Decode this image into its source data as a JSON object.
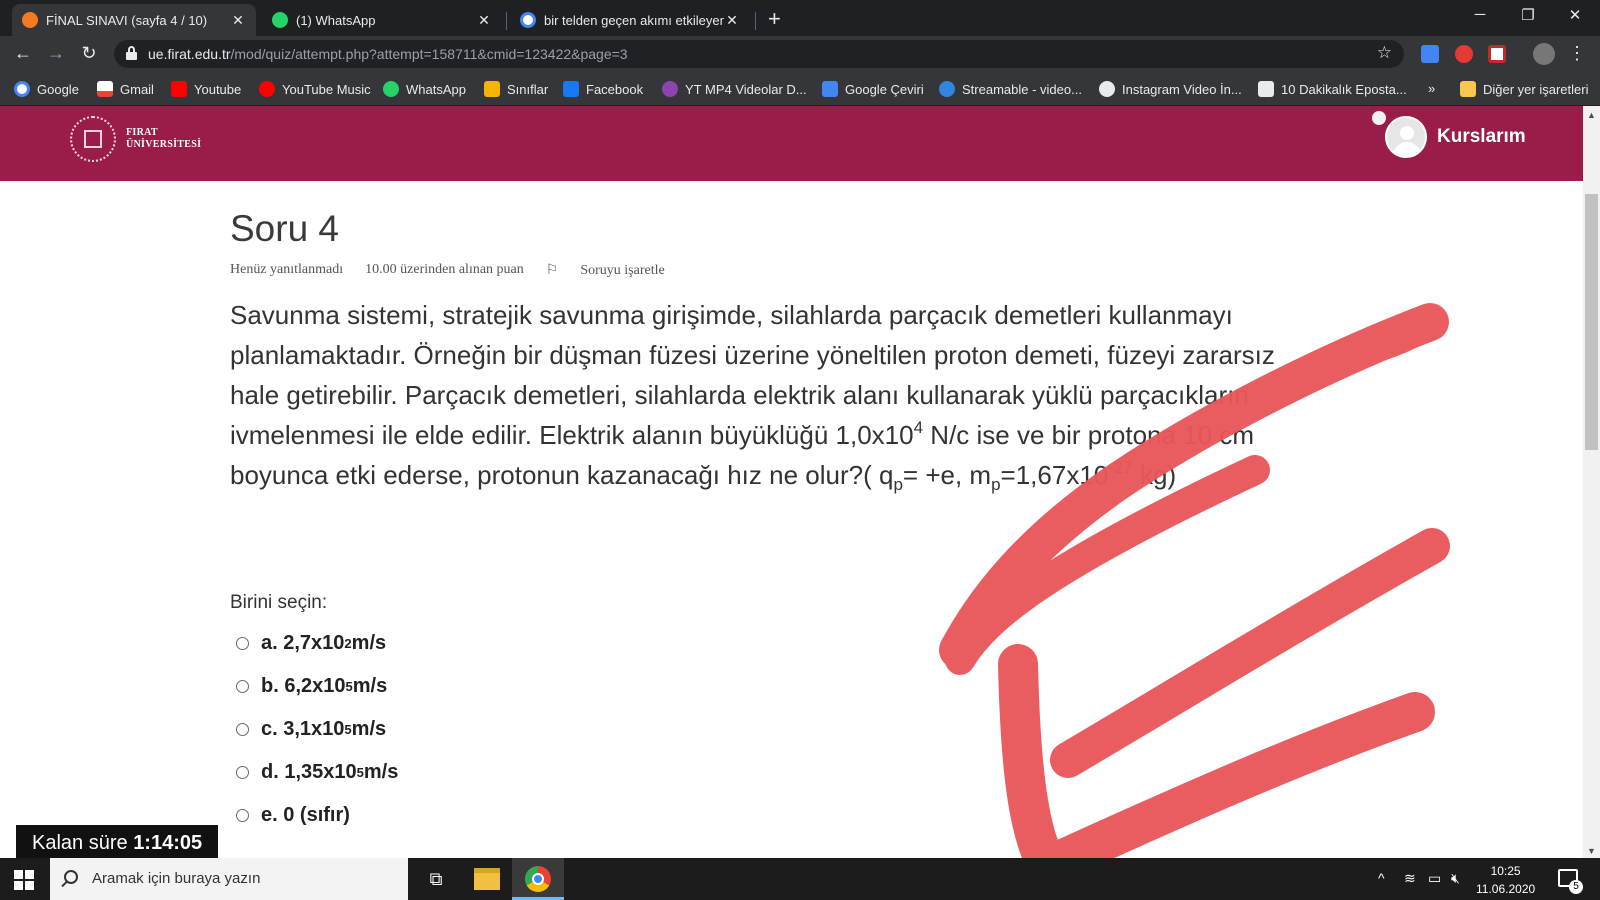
{
  "browser": {
    "tabs": [
      {
        "title": "FİNAL SINAVI (sayfa 4 / 10)",
        "active": true
      },
      {
        "title": "(1) WhatsApp",
        "active": false
      },
      {
        "title": "bir telden geçen akımı etkileyenle",
        "active": false
      }
    ],
    "url_host": "ue.firat.edu.tr",
    "url_path": "/mod/quiz/attempt.php?attempt=158711&cmid=123422&page=3",
    "bookmarks": [
      {
        "label": "Google",
        "icon": "google-icon",
        "color": "#4285f4"
      },
      {
        "label": "Gmail",
        "icon": "gmail-icon",
        "color": "#ea4335"
      },
      {
        "label": "Youtube",
        "icon": "youtube-icon",
        "color": "#ff0000"
      },
      {
        "label": "YouTube Music",
        "icon": "youtube-music-icon",
        "color": "#ff0000"
      },
      {
        "label": "WhatsApp",
        "icon": "whatsapp-icon",
        "color": "#25d366"
      },
      {
        "label": "Sınıflar",
        "icon": "classroom-icon",
        "color": "#f4b400"
      },
      {
        "label": "Facebook",
        "icon": "facebook-icon",
        "color": "#1877f2"
      },
      {
        "label": "YT MP4 Videolar D...",
        "icon": "yt-mp4-icon",
        "color": "#8e44ad"
      },
      {
        "label": "Google Çeviri",
        "icon": "translate-icon",
        "color": "#4285f4"
      },
      {
        "label": "Streamable - video...",
        "icon": "streamable-icon",
        "color": "#2e86de"
      },
      {
        "label": "Instagram Video İn...",
        "icon": "globe-icon",
        "color": "#e8eaed"
      },
      {
        "label": "10 Dakikalık Eposta...",
        "icon": "ten-minute-mail-icon",
        "color": "#e8eaed"
      }
    ],
    "bookmarks_overflow": "»",
    "other_bookmarks": "Diğer yer işaretleri"
  },
  "site": {
    "logo_line1": "FIRAT",
    "logo_line2": "ÜNİVERSİTESİ",
    "user_menu": "Kurslarım",
    "brand_color": "#9a1c4b"
  },
  "question": {
    "title": "Soru 4",
    "status": "Henüz yanıtlanmadı",
    "points": "10.00 üzerinden alınan puan",
    "flag_label": "Soruyu işaretle",
    "text_parts": {
      "p1": "Savunma sistemi, stratejik savunma girişimde, silahlarda parçacık demetleri kullanmayı planlamaktadır. Örneğin bir düşman füzesi üzerine yöneltilen proton demeti, füzeyi zararsız hale getirebilir. Parçacık demetleri, silahlarda elektrik alanı kullanarak yüklü parçacıkların ivmelenmesi ile elde edilir. Elektrik alanın büyüklüğü 1,0x10",
      "sup1": "4",
      "p2": " N/c ise ve bir protona 10 cm boyunca etki ederse, protonun kazanacağı hız ne olur?( q",
      "sub1": "p",
      "p3": "= +e,   m",
      "sub2": "p",
      "p4": "=1,67x10",
      "sup2": "-27",
      "p5": " kg)"
    },
    "prompt": "Birini seçin:",
    "answers": [
      {
        "letter": "a.",
        "base": "2,7x10",
        "exp": "2",
        "unit": " m/s"
      },
      {
        "letter": "b.",
        "base": "6,2x10",
        "exp": "5",
        "unit": " m/s"
      },
      {
        "letter": "c.",
        "base": "3,1x10",
        "exp": "5",
        "unit": " m/s"
      },
      {
        "letter": "d.",
        "base": "1,35x10",
        "exp": "5",
        "unit": " m/s"
      },
      {
        "letter": "e.",
        "base": "0 (sıfır)",
        "exp": "",
        "unit": ""
      }
    ]
  },
  "timer": {
    "label": "Kalan süre",
    "value": "1:14:05"
  },
  "taskbar": {
    "search_placeholder": "Aramak için buraya yazın",
    "time": "10:25",
    "date": "11.06.2020",
    "notification_count": "5"
  },
  "annotation_color": "#e9575b"
}
